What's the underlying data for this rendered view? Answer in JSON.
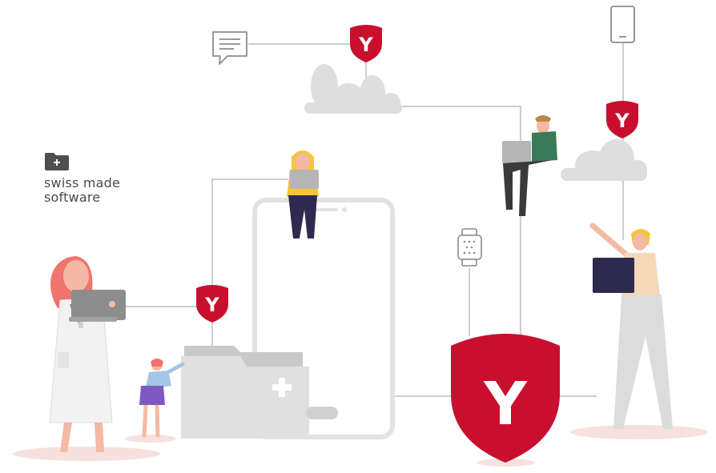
{
  "badge": {
    "line1": "swiss made",
    "line2": "software",
    "icon": "folder-plus-icon"
  },
  "shield": {
    "letter": "Y",
    "color": "#c8102e"
  },
  "colors": {
    "line": "#bdbdbd",
    "cloud": "#dedede",
    "device": "#e2e2e2",
    "skin": "#f4b9a4",
    "hair_red": "#f0736c",
    "hair_blond": "#f5c53a",
    "shadow": "#f7e1df"
  }
}
